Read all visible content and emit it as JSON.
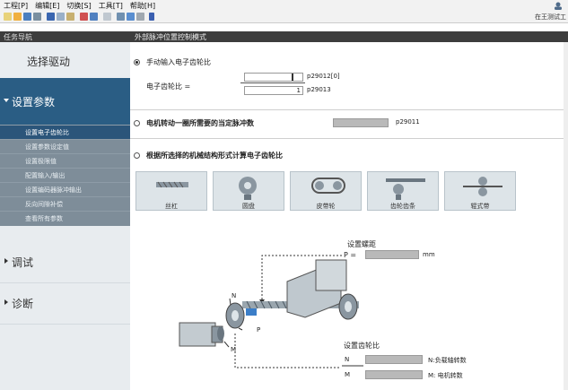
{
  "menubar": {
    "items": [
      "工程[P]",
      "编辑[E]",
      "切换[S]",
      "工具[T]",
      "帮助[H]"
    ]
  },
  "toolbar": {
    "user": "在王测试工"
  },
  "header": {
    "nav_title": "任务导航",
    "page_title": "外部脉冲位置控制模式"
  },
  "sidebar": {
    "top_item": "选择驱动",
    "section": "设置参数",
    "sub_items": [
      "设置电子齿轮比",
      "设置参数设定值",
      "设置极限值",
      "配置输入/输出",
      "设置编码器脉冲输出",
      "反向间隙补偿",
      "查看所有参数"
    ],
    "items": [
      "调试",
      "诊断"
    ]
  },
  "manual": {
    "option": "手动输入电子齿轮比",
    "ratio_label": "电子齿轮比 =",
    "numerator": "",
    "denominator": "1",
    "p_num": "p29012[0]",
    "p_den": "p29013"
  },
  "motor": {
    "option": "电机转动一圈所需要的当定脉冲数",
    "param": "p29011"
  },
  "calc": {
    "option": "根据所选择的机械结构形式计算电子齿轮比",
    "mechs": [
      "丝杠",
      "圆盘",
      "皮带轮",
      "齿轮齿条",
      "辊式带"
    ]
  },
  "diagram": {
    "pitch_title": "设置螺距",
    "pitch_eq": "P =",
    "unit": "mm",
    "gear_title": "设置齿轮比",
    "n": "N",
    "m": "M",
    "n_desc": "N:负载轴转数",
    "m_desc": "M: 电机转数",
    "lbl_n": "N",
    "lbl_p": "P",
    "lbl_m": "M"
  },
  "colors": {
    "nav_active": "#2a5d84",
    "nav_sub": "#7e8d99",
    "headbar": "#3d3d3d"
  }
}
